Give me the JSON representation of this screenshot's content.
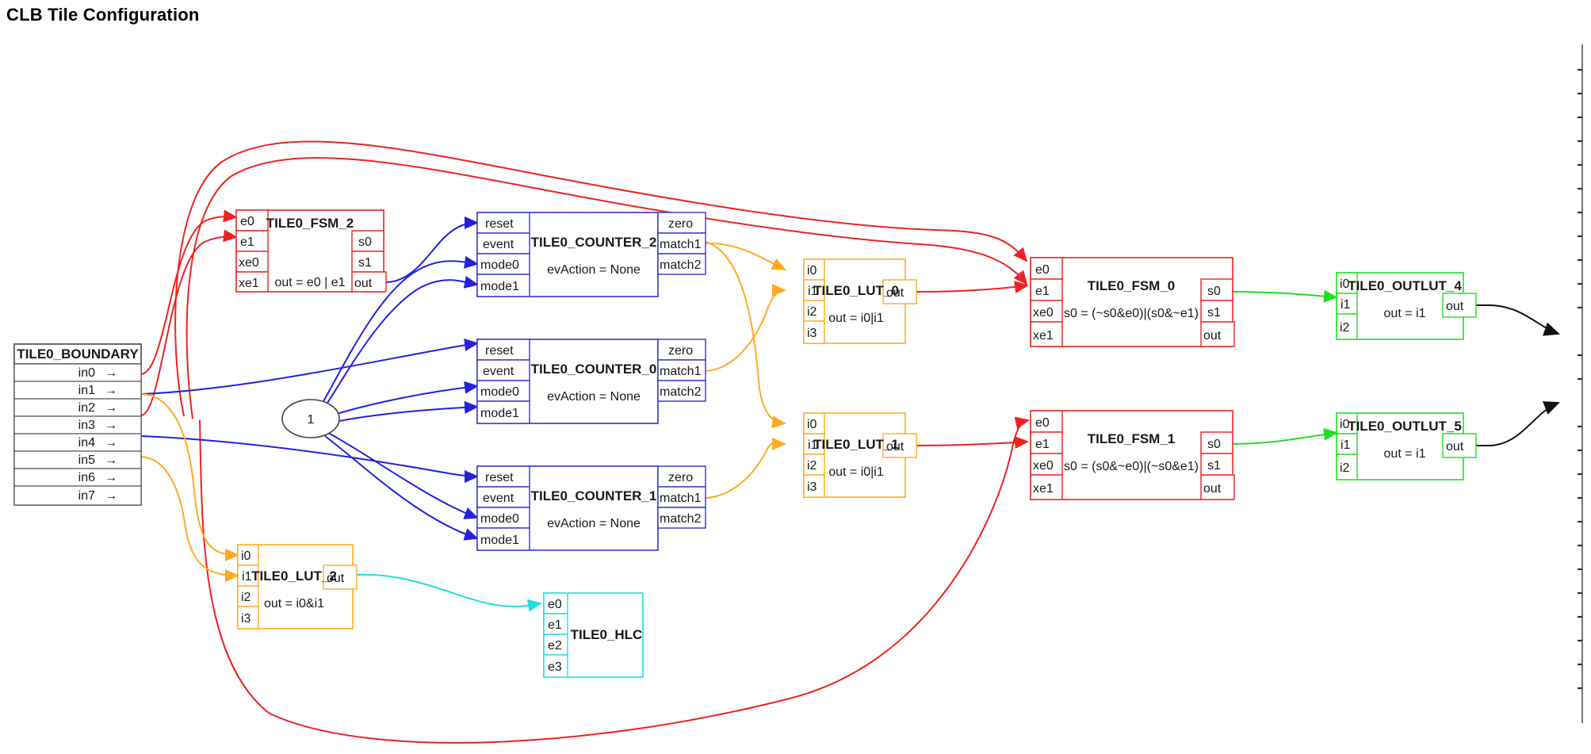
{
  "page": {
    "title": "CLB Tile Configuration",
    "background": "#ffffff"
  },
  "colors": {
    "red": "#ee2222",
    "blue": "#2222dd",
    "orange": "#ffaa22",
    "green": "#22dd22",
    "cyan": "#22dddd",
    "black": "#000000",
    "gray": "#555555",
    "text": "#1a1a1a"
  },
  "boundary": {
    "name": "TILE0_BOUNDARY",
    "ports": [
      "in0",
      "in1",
      "in2",
      "in3",
      "in4",
      "in5",
      "in6",
      "in7"
    ],
    "arrow_glyph": "→"
  },
  "constant_node": {
    "label": "1"
  },
  "blocks": [
    {
      "id": "fsm2",
      "title": "TILE0_FSM_2",
      "body": "out = e0 | e1",
      "color": "red",
      "inputs": [
        "e0",
        "e1",
        "xe0",
        "xe1"
      ],
      "outputs": [
        "s0",
        "s1",
        "out"
      ]
    },
    {
      "id": "counter2",
      "title": "TILE0_COUNTER_2",
      "body": "evAction = None",
      "color": "blue",
      "inputs": [
        "reset",
        "event",
        "mode0",
        "mode1"
      ],
      "outputs": [
        "zero",
        "match1",
        "match2"
      ]
    },
    {
      "id": "counter0",
      "title": "TILE0_COUNTER_0",
      "body": "evAction = None",
      "color": "blue",
      "inputs": [
        "reset",
        "event",
        "mode0",
        "mode1"
      ],
      "outputs": [
        "zero",
        "match1",
        "match2"
      ]
    },
    {
      "id": "counter1",
      "title": "TILE0_COUNTER_1",
      "body": "evAction = None",
      "color": "blue",
      "inputs": [
        "reset",
        "event",
        "mode0",
        "mode1"
      ],
      "outputs": [
        "zero",
        "match1",
        "match2"
      ]
    },
    {
      "id": "lut0",
      "title": "TILE0_LUT_0",
      "body": "out = i0|i1",
      "color": "orange",
      "inputs": [
        "i0",
        "i1",
        "i2",
        "i3"
      ],
      "outputs": [
        "out"
      ]
    },
    {
      "id": "lut1",
      "title": "TILE0_LUT_1",
      "body": "out = i0|i1",
      "color": "orange",
      "inputs": [
        "i0",
        "i1",
        "i2",
        "i3"
      ],
      "outputs": [
        "out"
      ]
    },
    {
      "id": "lut2",
      "title": "TILE0_LUT_2",
      "body": "out = i0&i1",
      "color": "orange",
      "inputs": [
        "i0",
        "i1",
        "i2",
        "i3"
      ],
      "outputs": [
        "out"
      ]
    },
    {
      "id": "fsm0",
      "title": "TILE0_FSM_0",
      "body": "s0 = (~s0&e0)|(s0&~e1)",
      "color": "red",
      "inputs": [
        "e0",
        "e1",
        "xe0",
        "xe1"
      ],
      "outputs": [
        "s0",
        "s1",
        "out"
      ]
    },
    {
      "id": "fsm1",
      "title": "TILE0_FSM_1",
      "body": "s0 = (s0&~e0)|(~s0&e1)",
      "color": "red",
      "inputs": [
        "e0",
        "e1",
        "xe0",
        "xe1"
      ],
      "outputs": [
        "s0",
        "s1",
        "out"
      ]
    },
    {
      "id": "outlut4",
      "title": "TILE0_OUTLUT_4",
      "body": "out = i1",
      "color": "green",
      "inputs": [
        "i0",
        "i1",
        "i2"
      ],
      "outputs": [
        "out"
      ]
    },
    {
      "id": "outlut5",
      "title": "TILE0_OUTLUT_5",
      "body": "out =  i1",
      "color": "green",
      "inputs": [
        "i0",
        "i1",
        "i2"
      ],
      "outputs": [
        "out"
      ]
    },
    {
      "id": "hlc",
      "title": "TILE0_HLC",
      "body": "",
      "color": "cyan",
      "inputs": [
        "e0",
        "e1",
        "e2",
        "e3"
      ],
      "outputs": []
    }
  ],
  "right_edge": {
    "name": "output-boundary-partial",
    "visible": true
  }
}
